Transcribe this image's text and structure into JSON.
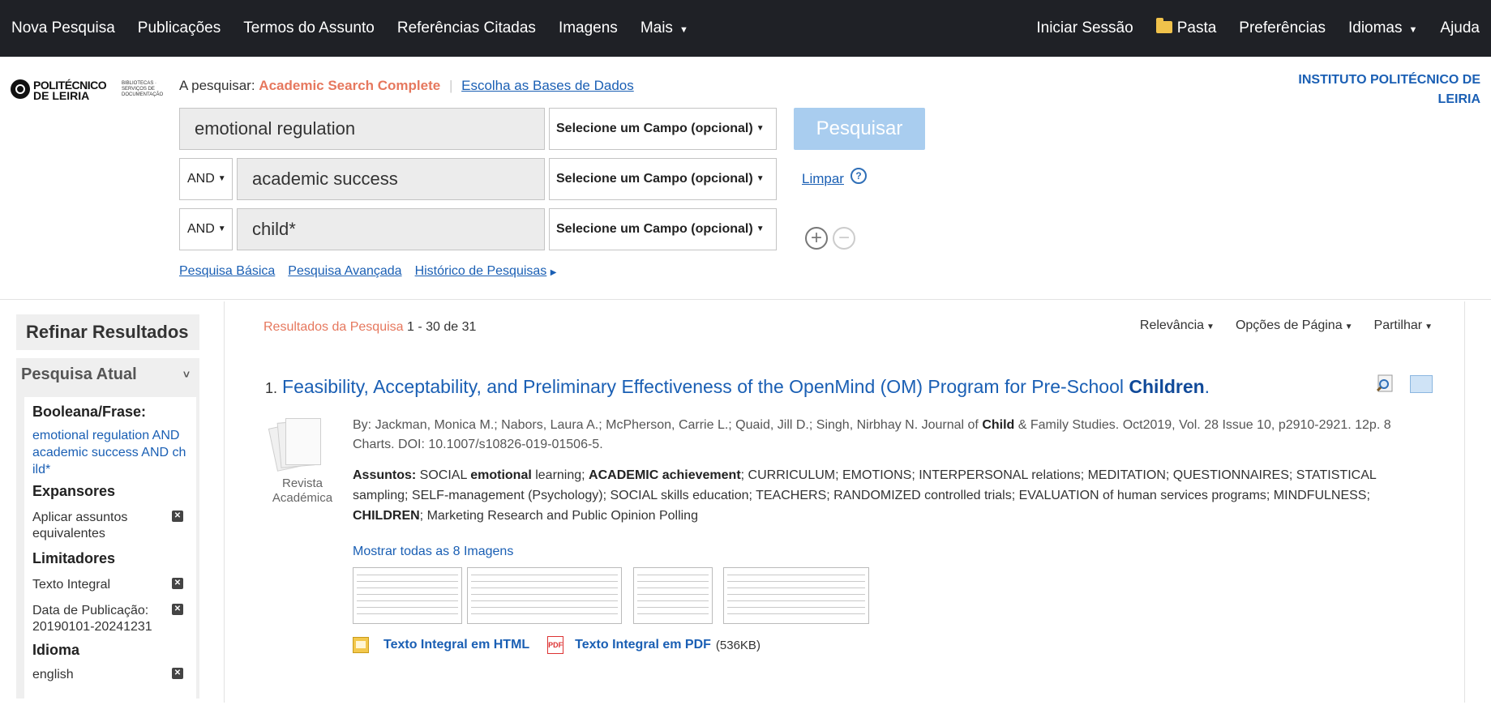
{
  "topnav": {
    "left": [
      "Nova Pesquisa",
      "Publicações",
      "Termos do Assunto",
      "Referências Citadas",
      "Imagens",
      "Mais"
    ],
    "right": [
      "Iniciar Sessão",
      "Pasta",
      "Preferências",
      "Idiomas",
      "Ajuda"
    ]
  },
  "logo": {
    "line1": "POLITÉCNICO",
    "line2": "DE LEIRIA",
    "sub": "BIBLIOTECAS · SERVIÇOS DE DOCUMENTAÇÃO"
  },
  "search_context": {
    "prefix": "A pesquisar:",
    "database": "Academic Search Complete",
    "choose_db_link": "Escolha as Bases de Dados"
  },
  "institute": "INSTITUTO POLITÉCNICO DE LEIRIA",
  "search": {
    "rows": [
      {
        "bool": "",
        "term": "emotional regulation",
        "field": "Selecione um Campo (opcional)"
      },
      {
        "bool": "AND",
        "term": "academic success",
        "field": "Selecione um Campo (opcional)"
      },
      {
        "bool": "AND",
        "term": "child*",
        "field": "Selecione um Campo (opcional)"
      }
    ],
    "search_button": "Pesquisar",
    "clear_link": "Limpar",
    "help_symbol": "?",
    "links": [
      "Pesquisa Básica",
      "Pesquisa Avançada",
      "Histórico de Pesquisas"
    ]
  },
  "sidebar": {
    "refine_title": "Refinar Resultados",
    "current_search_title": "Pesquisa Atual",
    "boolean_heading": "Booleana/Frase:",
    "boolean_query": "emotional regulation AND academic success AND child*",
    "expanders_heading": "Expansores",
    "expanders": [
      "Aplicar assuntos equivalentes"
    ],
    "limiters_heading": "Limitadores",
    "limiters": [
      "Texto Integral",
      "Data de Publicação: 20190101-20241231"
    ],
    "language_heading": "Idioma",
    "languages": [
      "english"
    ]
  },
  "results": {
    "summary_label": "Resultados da Pesquisa",
    "summary_range": "1 - 30 de 31",
    "controls": [
      "Relevância",
      "Opções de Página",
      "Partilhar"
    ],
    "items": [
      {
        "number": "1.",
        "title_start": "Feasibility, Acceptability, and Preliminary Effectiveness of the OpenMind (OM) Program for Pre-School ",
        "title_bold": "Children",
        "title_end": ".",
        "doc_type": "Revista Académica",
        "meta_prefix": "By: Jackman, Monica M.; Nabors, Laura A.; McPherson, Carrie L.; Quaid, Jill D.; Singh, Nirbhay N. Journal of ",
        "meta_bold": "Child",
        "meta_suffix": " & Family Studies. Oct2019, Vol. 28 Issue 10, p2910-2921. 12p. 8 Charts. DOI: 10.1007/s10826-019-01506-5.",
        "subjects_label": "Assuntos:",
        "subjects_p1": " SOCIAL ",
        "subjects_b1": "emotional",
        "subjects_p2": " learning; ",
        "subjects_b2": "ACADEMIC achievement",
        "subjects_p3": "; CURRICULUM; EMOTIONS; INTERPERSONAL relations; MEDITATION; QUESTIONNAIRES; STATISTICAL sampling; SELF-management (Psychology); SOCIAL skills education; TEACHERS; RANDOMIZED controlled trials; EVALUATION of human services programs; MINDFULNESS; ",
        "subjects_b3": "CHILDREN",
        "subjects_p4": "; Marketing Research and Public Opinion Polling",
        "show_images": "Mostrar todas as 8 Imagens",
        "fulltext_html": "Texto Integral em HTML",
        "fulltext_pdf": "Texto Integral em PDF",
        "pdf_size": "(536KB)"
      }
    ]
  },
  "colors": {
    "topbar": "#1f2126",
    "link": "#1a5fb4",
    "accent_db": "#e6785e",
    "search_button": "#a9cdef"
  }
}
